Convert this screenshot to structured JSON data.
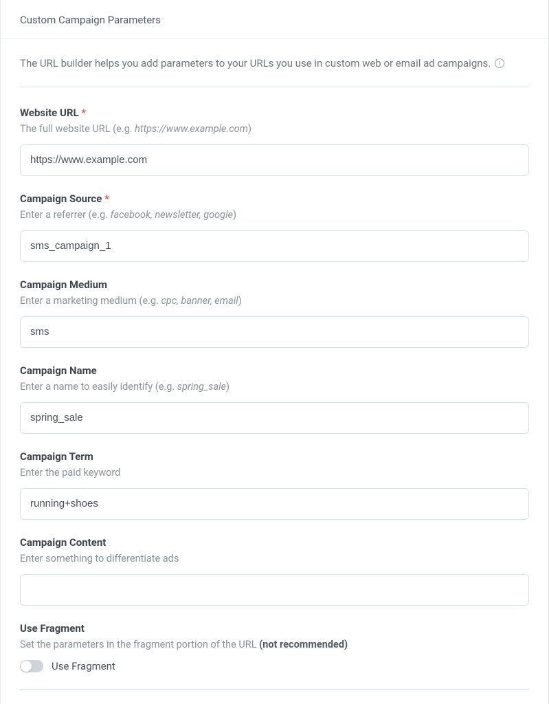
{
  "header": {
    "title": "Custom Campaign Parameters"
  },
  "intro": {
    "text": "The URL builder helps you add parameters to your URLs you use in custom web or email ad campaigns."
  },
  "fields": {
    "website_url": {
      "label": "Website URL",
      "required_mark": "*",
      "help_pre": "The full website URL (e.g. ",
      "help_italic": "https://www.example.com",
      "help_post": ")",
      "value": "https://www.example.com"
    },
    "campaign_source": {
      "label": "Campaign Source",
      "required_mark": "*",
      "help_pre": "Enter a referrer (e.g. ",
      "help_italic": "facebook, newsletter, google",
      "help_post": ")",
      "value": "sms_campaign_1"
    },
    "campaign_medium": {
      "label": "Campaign Medium",
      "help_pre": "Enter a marketing medium (e.g. ",
      "help_italic": "cpc, banner, email",
      "help_post": ")",
      "value": "sms"
    },
    "campaign_name": {
      "label": "Campaign Name",
      "help_pre": "Enter a name to easily identify (e.g. ",
      "help_italic": "spring_sale",
      "help_post": ")",
      "value": "spring_sale"
    },
    "campaign_term": {
      "label": "Campaign Term",
      "help": "Enter the paid keyword",
      "value": "running+shoes"
    },
    "campaign_content": {
      "label": "Campaign Content",
      "help": "Enter something to differentiate ads",
      "value": ""
    },
    "use_fragment": {
      "label": "Use Fragment",
      "help_pre": "Set the parameters in the fragment portion of the URL ",
      "help_bold": "(not recommended)",
      "toggle_label": "Use Fragment",
      "value": false
    }
  }
}
